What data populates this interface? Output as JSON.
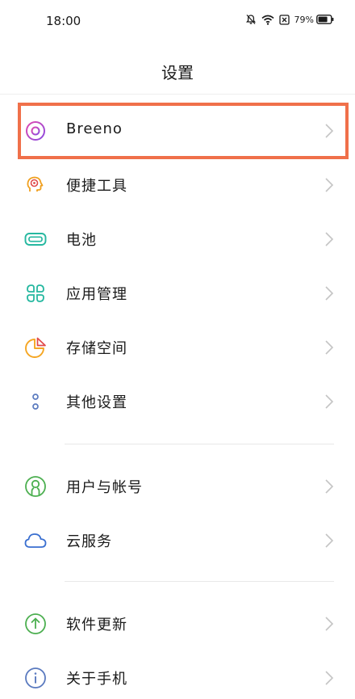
{
  "status_bar": {
    "time": "18:00",
    "battery_percent": "79%",
    "icons": [
      "mute-bell-icon",
      "wifi-icon",
      "close-box-icon",
      "battery-icon"
    ]
  },
  "header": {
    "title": "设置"
  },
  "settings": {
    "items": [
      {
        "label": "Breeno",
        "icon": "breeno-icon",
        "color": "#c04ad0"
      },
      {
        "label": "便捷工具",
        "icon": "tools-icon",
        "color": "#f0a020"
      },
      {
        "label": "电池",
        "icon": "battery-icon",
        "color": "#26b8a0"
      },
      {
        "label": "应用管理",
        "icon": "apps-icon",
        "color": "#26b8a0"
      },
      {
        "label": "存储空间",
        "icon": "storage-icon",
        "color": "#f5a623"
      },
      {
        "label": "其他设置",
        "icon": "more-icon",
        "color": "#5a7abf"
      },
      {
        "label": "用户与帐号",
        "icon": "user-icon",
        "color": "#4caf50"
      },
      {
        "label": "云服务",
        "icon": "cloud-icon",
        "color": "#3a6fd0"
      },
      {
        "label": "软件更新",
        "icon": "update-icon",
        "color": "#4caf50"
      },
      {
        "label": "关于手机",
        "icon": "info-icon",
        "color": "#5a7abf"
      }
    ]
  },
  "highlight": {
    "color": "#f0704a",
    "target": "Breeno"
  }
}
